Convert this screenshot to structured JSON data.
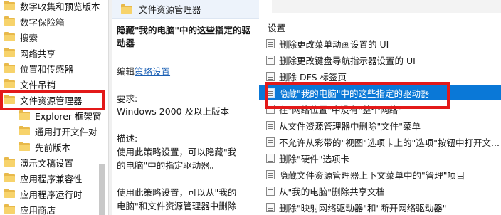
{
  "tree": {
    "items": [
      {
        "label": "数字收集和预览版本"
      },
      {
        "label": "数字保险箱"
      },
      {
        "label": "搜索"
      },
      {
        "label": "网络共享"
      },
      {
        "label": "位置和传感器"
      },
      {
        "label": "文件吊销"
      },
      {
        "label": "文件资源管理器",
        "selected": true
      },
      {
        "label": "Explorer 框架窗"
      },
      {
        "label": "通用打开文件对"
      },
      {
        "label": "先前版本"
      },
      {
        "label": "演示文稿设置"
      },
      {
        "label": "应用程序兼容性"
      },
      {
        "label": "应用程序运行时"
      },
      {
        "label": "应用商店"
      }
    ]
  },
  "description": {
    "header": "文件资源管理器",
    "title": "隐藏\"我的电脑\"中的这些指定的驱动器",
    "edit_prefix": "编辑",
    "edit_link": "策略设置",
    "requirements_label": "要求:",
    "requirements_value": "Windows 2000 及以上版本",
    "desc_label": "描述:",
    "desc_p1_l1": "使用此策略设置，可以隐藏\"我",
    "desc_p1_l2": "的电脑\"中的指定驱动器。",
    "desc_p2_l1": "使用此策略设置，可以从\"我的",
    "desc_p2_l2": "电脑\"和文件资源管理器中删除"
  },
  "settings": {
    "header": "设置",
    "rows": [
      {
        "label": "删除更改菜单动画设置的 UI"
      },
      {
        "label": "删除更改键盘导航指示器设置的 UI"
      },
      {
        "label": "删除 DFS 标签页"
      },
      {
        "label": "隐藏\"我的电脑\"中的这些指定的驱动器",
        "selected": true
      },
      {
        "label": "在\"网络位置\"中没有\"整个网络\""
      },
      {
        "label": "从文件资源管理器中删除\"文件\"菜单"
      },
      {
        "label": "不允许从彩带的\"视图\"选项卡上的\"选项\"按钮中打开文..."
      },
      {
        "label": "删除\"硬件\"选项卡"
      },
      {
        "label": "隐藏文件资源管理器上下文菜单中的\"管理\"项目"
      },
      {
        "label": "从\"我的电脑\"删除共享文档"
      },
      {
        "label": "删除\"映射网络驱动器\"和\"断开网络驱动器\""
      }
    ]
  },
  "colors": {
    "highlight_box": "#e31919",
    "selection": "#0a78d7",
    "folder": "#f7d36b"
  }
}
